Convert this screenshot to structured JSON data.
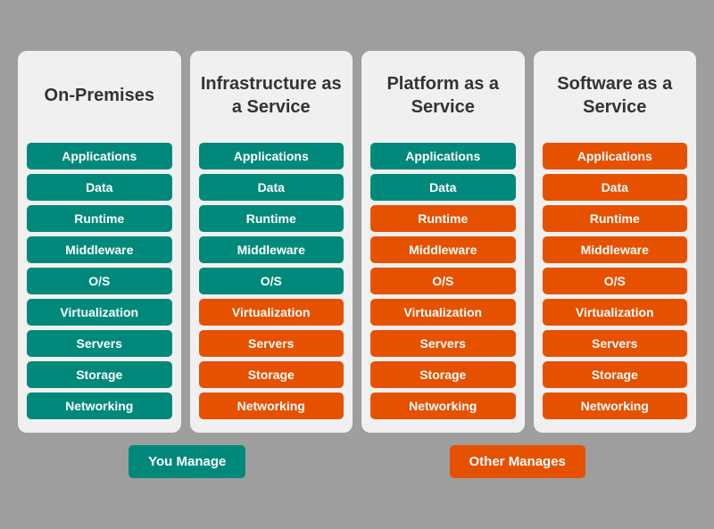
{
  "columns": [
    {
      "id": "on-premises",
      "title": "On-Premises",
      "items": [
        {
          "label": "Applications",
          "color": "teal"
        },
        {
          "label": "Data",
          "color": "teal"
        },
        {
          "label": "Runtime",
          "color": "teal"
        },
        {
          "label": "Middleware",
          "color": "teal"
        },
        {
          "label": "O/S",
          "color": "teal"
        },
        {
          "label": "Virtualization",
          "color": "teal"
        },
        {
          "label": "Servers",
          "color": "teal"
        },
        {
          "label": "Storage",
          "color": "teal"
        },
        {
          "label": "Networking",
          "color": "teal"
        }
      ]
    },
    {
      "id": "iaas",
      "title": "Infrastructure as a Service",
      "items": [
        {
          "label": "Applications",
          "color": "teal"
        },
        {
          "label": "Data",
          "color": "teal"
        },
        {
          "label": "Runtime",
          "color": "teal"
        },
        {
          "label": "Middleware",
          "color": "teal"
        },
        {
          "label": "O/S",
          "color": "teal"
        },
        {
          "label": "Virtualization",
          "color": "orange"
        },
        {
          "label": "Servers",
          "color": "orange"
        },
        {
          "label": "Storage",
          "color": "orange"
        },
        {
          "label": "Networking",
          "color": "orange"
        }
      ]
    },
    {
      "id": "paas",
      "title": "Platform as a Service",
      "items": [
        {
          "label": "Applications",
          "color": "teal"
        },
        {
          "label": "Data",
          "color": "teal"
        },
        {
          "label": "Runtime",
          "color": "orange"
        },
        {
          "label": "Middleware",
          "color": "orange"
        },
        {
          "label": "O/S",
          "color": "orange"
        },
        {
          "label": "Virtualization",
          "color": "orange"
        },
        {
          "label": "Servers",
          "color": "orange"
        },
        {
          "label": "Storage",
          "color": "orange"
        },
        {
          "label": "Networking",
          "color": "orange"
        }
      ]
    },
    {
      "id": "saas",
      "title": "Software as a Service",
      "items": [
        {
          "label": "Applications",
          "color": "orange"
        },
        {
          "label": "Data",
          "color": "orange"
        },
        {
          "label": "Runtime",
          "color": "orange"
        },
        {
          "label": "Middleware",
          "color": "orange"
        },
        {
          "label": "O/S",
          "color": "orange"
        },
        {
          "label": "Virtualization",
          "color": "orange"
        },
        {
          "label": "Servers",
          "color": "orange"
        },
        {
          "label": "Storage",
          "color": "orange"
        },
        {
          "label": "Networking",
          "color": "orange"
        }
      ]
    }
  ],
  "legend": {
    "you_manage": "You Manage",
    "other_manages": "Other Manages"
  }
}
